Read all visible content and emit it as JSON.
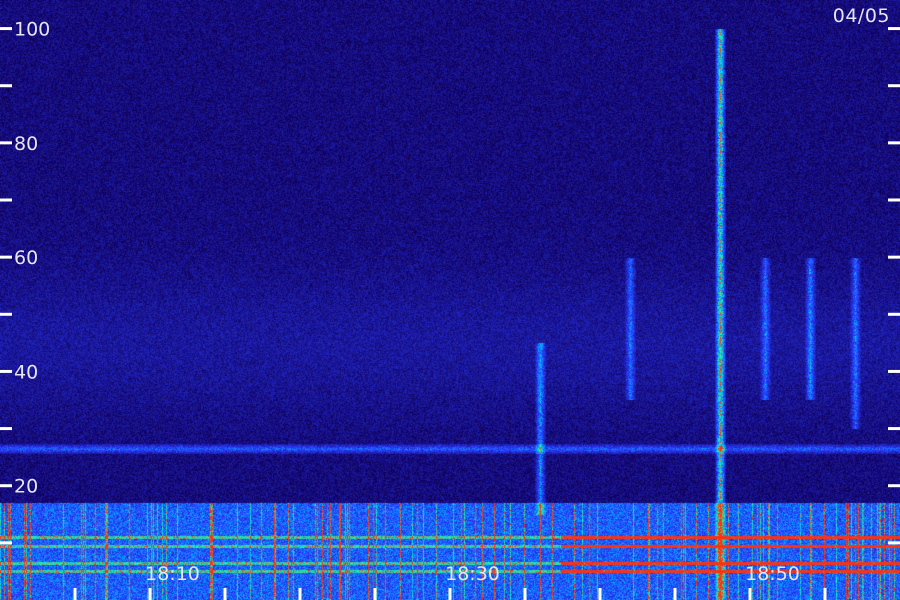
{
  "chart_data": {
    "type": "heatmap",
    "title": "",
    "date_label": "04/05",
    "y_axis": {
      "range": [
        0,
        105
      ],
      "ticks": [
        {
          "value": 100,
          "label": "100"
        },
        {
          "value": 90,
          "label": ""
        },
        {
          "value": 80,
          "label": "80"
        },
        {
          "value": 70,
          "label": ""
        },
        {
          "value": 60,
          "label": "60"
        },
        {
          "value": 50,
          "label": ""
        },
        {
          "value": 40,
          "label": "40"
        },
        {
          "value": 30,
          "label": ""
        },
        {
          "value": 20,
          "label": "20"
        },
        {
          "value": 10,
          "label": ""
        }
      ]
    },
    "x_axis": {
      "range": [
        -1.5,
        58.5
      ],
      "ticks": [
        {
          "value": 3.5,
          "label": ""
        },
        {
          "value": 8.5,
          "label": ""
        },
        {
          "value": 13.5,
          "label": ""
        },
        {
          "value": 18.5,
          "label": ""
        },
        {
          "value": 23.5,
          "label": ""
        },
        {
          "value": 28.5,
          "label": ""
        },
        {
          "value": 33.5,
          "label": ""
        },
        {
          "value": 38.5,
          "label": ""
        },
        {
          "value": 43.5,
          "label": ""
        },
        {
          "value": 48.5,
          "label": ""
        },
        {
          "value": 53.5,
          "label": ""
        }
      ],
      "labels": [
        {
          "value": 10,
          "label": "18:10"
        },
        {
          "value": 30,
          "label": "18:30"
        },
        {
          "value": 50,
          "label": "18:50"
        }
      ]
    },
    "features": {
      "background_level": 0.18,
      "interference_band_y": 26.5,
      "low_frequency_noise_top_y": 17,
      "steady_lines_y": [
        5,
        6.5,
        9.5,
        11
      ],
      "vertical_bursts": [
        {
          "x": 34.5,
          "y_range": [
            15,
            45
          ],
          "intensity": 0.45
        },
        {
          "x": 46.5,
          "y_range": [
            0,
            100
          ],
          "intensity": 0.75
        },
        {
          "x": 40.5,
          "y_range": [
            35,
            60
          ],
          "intensity": 0.35
        },
        {
          "x": 49.5,
          "y_range": [
            35,
            60
          ],
          "intensity": 0.35
        },
        {
          "x": 52.5,
          "y_range": [
            35,
            60
          ],
          "intensity": 0.4
        },
        {
          "x": 55.5,
          "y_range": [
            30,
            60
          ],
          "intensity": 0.35
        }
      ]
    },
    "colors": {
      "low": "#10005a",
      "mid": "#2a3cff",
      "high": "#20ffa0",
      "max": "#ff3010"
    }
  }
}
